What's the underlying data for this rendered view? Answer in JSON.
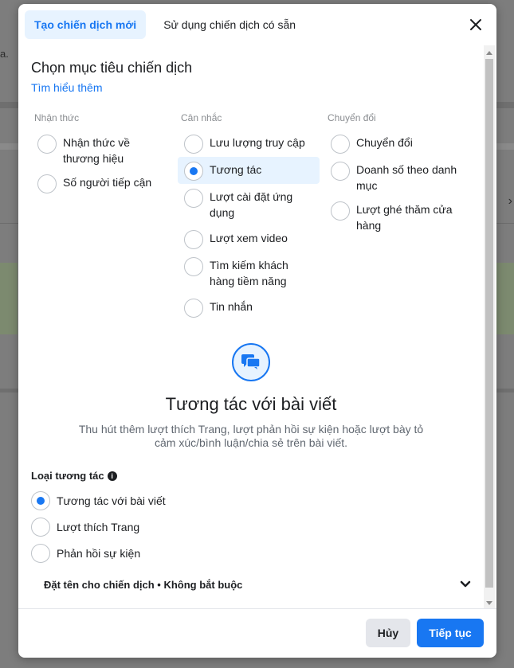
{
  "background": {
    "text": "a."
  },
  "tabs": [
    {
      "label": "Tạo chiến dịch mới"
    },
    {
      "label": "Sử dụng chiến dịch có sẵn"
    }
  ],
  "heading": "Chọn mục tiêu chiến dịch",
  "learn_more": "Tìm hiểu thêm",
  "columns": [
    {
      "title": "Nhận thức",
      "options": [
        "Nhận thức về thương hiệu",
        "Số người tiếp cận"
      ]
    },
    {
      "title": "Cân nhắc",
      "options": [
        "Lưu lượng truy cập",
        "Tương tác",
        "Lượt cài đặt ứng dụng",
        "Lượt xem video",
        "Tìm kiếm khách hàng tiềm năng",
        "Tin nhắn"
      ]
    },
    {
      "title": "Chuyển đổi",
      "options": [
        "Chuyển đổi",
        "Doanh số theo danh mục",
        "Lượt ghé thăm cửa hàng"
      ]
    }
  ],
  "selected_objective": "Tương tác",
  "feature": {
    "icon": "chat-bubbles-icon",
    "title": "Tương tác với bài viết",
    "description": "Thu hút thêm lượt thích Trang, lượt phản hồi sự kiện hoặc lượt bày tỏ cảm xúc/bình luận/chia sẻ trên bài viết."
  },
  "engagement": {
    "label": "Loại tương tác",
    "options": [
      "Tương tác với bài viết",
      "Lượt thích Trang",
      "Phản hồi sự kiện"
    ],
    "selected": "Tương tác với bài viết"
  },
  "campaign_name_row": "Đặt tên cho chiến dịch • Không bắt buộc",
  "footer": {
    "cancel": "Hủy",
    "continue": "Tiếp tục"
  },
  "colors": {
    "accent": "#1877f2",
    "accent_bg": "#e7f3ff"
  }
}
